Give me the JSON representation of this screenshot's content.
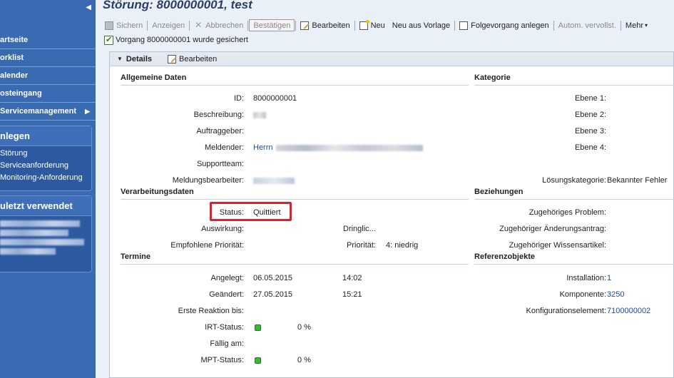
{
  "sidebar": {
    "collapse_glyph": "◀",
    "nav": [
      {
        "label": "artseite"
      },
      {
        "label": "orklist"
      },
      {
        "label": "alender"
      },
      {
        "label": "osteingang"
      },
      {
        "label": "Servicemanagement",
        "arrow": "▶"
      }
    ],
    "anlegen": {
      "title": "nlegen",
      "links": [
        "Störung",
        "Serviceanforderung",
        "Monitoring-Anforderung"
      ]
    },
    "zuletzt": {
      "title": "uletzt verwendet"
    }
  },
  "page": {
    "title": "Störung: 8000000001, test"
  },
  "toolbar": {
    "sichern": "Sichern",
    "anzeigen": "Anzeigen",
    "abbrechen": "Abbrechen",
    "bestaetigen": "Bestätigen",
    "bearbeiten": "Bearbeiten",
    "neu": "Neu",
    "neu_aus_vorlage": "Neu aus Vorlage",
    "folgevorgang": "Folgevorgang anlegen",
    "autom": "Autom. vervollst.",
    "mehr": "Mehr",
    "mehr_chevron": "▾"
  },
  "message": "Vorgang 8000000001 wurde gesichert",
  "details": {
    "title": "Details",
    "toggle_glyph": "▼",
    "edit_label": "Bearbeiten",
    "allgemein": {
      "title": "Allgemeine Daten",
      "id_label": "ID:",
      "id_value": "8000000001",
      "beschreibung_label": "Beschreibung:",
      "auftraggeber_label": "Auftraggeber:",
      "meldender_label": "Meldender:",
      "meldender_value": "Herrn",
      "supportteam_label": "Supportteam:",
      "bearbeiter_label": "Meldungsbearbeiter:"
    },
    "kategorie": {
      "title": "Kategorie",
      "ebene1": "Ebene 1:",
      "ebene2": "Ebene 2:",
      "ebene3": "Ebene 3:",
      "ebene4": "Ebene 4:",
      "loesung_label": "Lösungskategorie:",
      "loesung_value": "Bekannter Fehler"
    },
    "verarbeitung": {
      "title": "Verarbeitungsdaten",
      "status_label": "Status:",
      "status_value": "Quittiert",
      "auswirkung_label": "Auswirkung:",
      "dringlich_label": "Dringlic...",
      "empfohlen_label": "Empfohlene Priorität:",
      "prioritaet_label": "Priorität:",
      "prioritaet_value": "4: niedrig"
    },
    "beziehungen": {
      "title": "Beziehungen",
      "problem": "Zugehöriges Problem:",
      "aenderung": "Zugehöriger Änderungsantrag:",
      "wissen": "Zugehöriger Wissensartikel:"
    },
    "termine": {
      "title": "Termine",
      "angelegt_label": "Angelegt:",
      "angelegt_date": "06.05.2015",
      "angelegt_time": "14:02",
      "geaendert_label": "Geändert:",
      "geaendert_date": "27.05.2015",
      "geaendert_time": "15:21",
      "erste_label": "Erste Reaktion bis:",
      "irt_label": "IRT-Status:",
      "irt_value": "0 %",
      "faellig_label": "Fällig am:",
      "mpt_label": "MPT-Status:",
      "mpt_value": "0 %"
    },
    "referenz": {
      "title": "Referenzobjekte",
      "installation_label": "Installation:",
      "installation_value": "1",
      "komponente_label": "Komponente:",
      "komponente_value": "3250",
      "konfig_label": "Konfigurationselement:",
      "konfig_value": "7100000002"
    }
  }
}
